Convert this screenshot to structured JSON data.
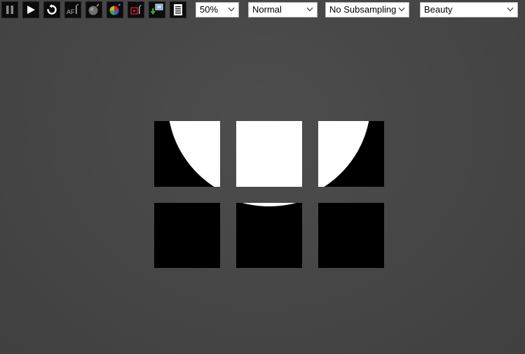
{
  "toolbar": {
    "buttons": [
      {
        "name": "pause-button",
        "icon": "pause-icon"
      },
      {
        "name": "play-button",
        "icon": "play-icon"
      },
      {
        "name": "refresh-button",
        "icon": "refresh-icon"
      },
      {
        "name": "aperture-button",
        "icon": "aperture-icon",
        "label": "AF"
      },
      {
        "name": "sphere-render-button",
        "icon": "sphere-icon"
      },
      {
        "name": "color-wheel-button",
        "icon": "color-wheel-icon"
      },
      {
        "name": "region-button",
        "icon": "region-icon"
      },
      {
        "name": "save-image-button",
        "icon": "save-image-icon"
      },
      {
        "name": "log-button",
        "icon": "log-icon"
      }
    ],
    "zoom": {
      "value": "50%"
    },
    "mode": {
      "value": "Normal"
    },
    "subsampling": {
      "value": "No Subsampling"
    },
    "render_pass": {
      "value": "Beauty"
    }
  },
  "colors": {
    "background": "#474747",
    "button_bg": "#0b0b0b",
    "tile_dark": "#000000",
    "tile_light": "#ffffff",
    "accent_red": "#d0213a",
    "accent_green": "#3aa845"
  }
}
